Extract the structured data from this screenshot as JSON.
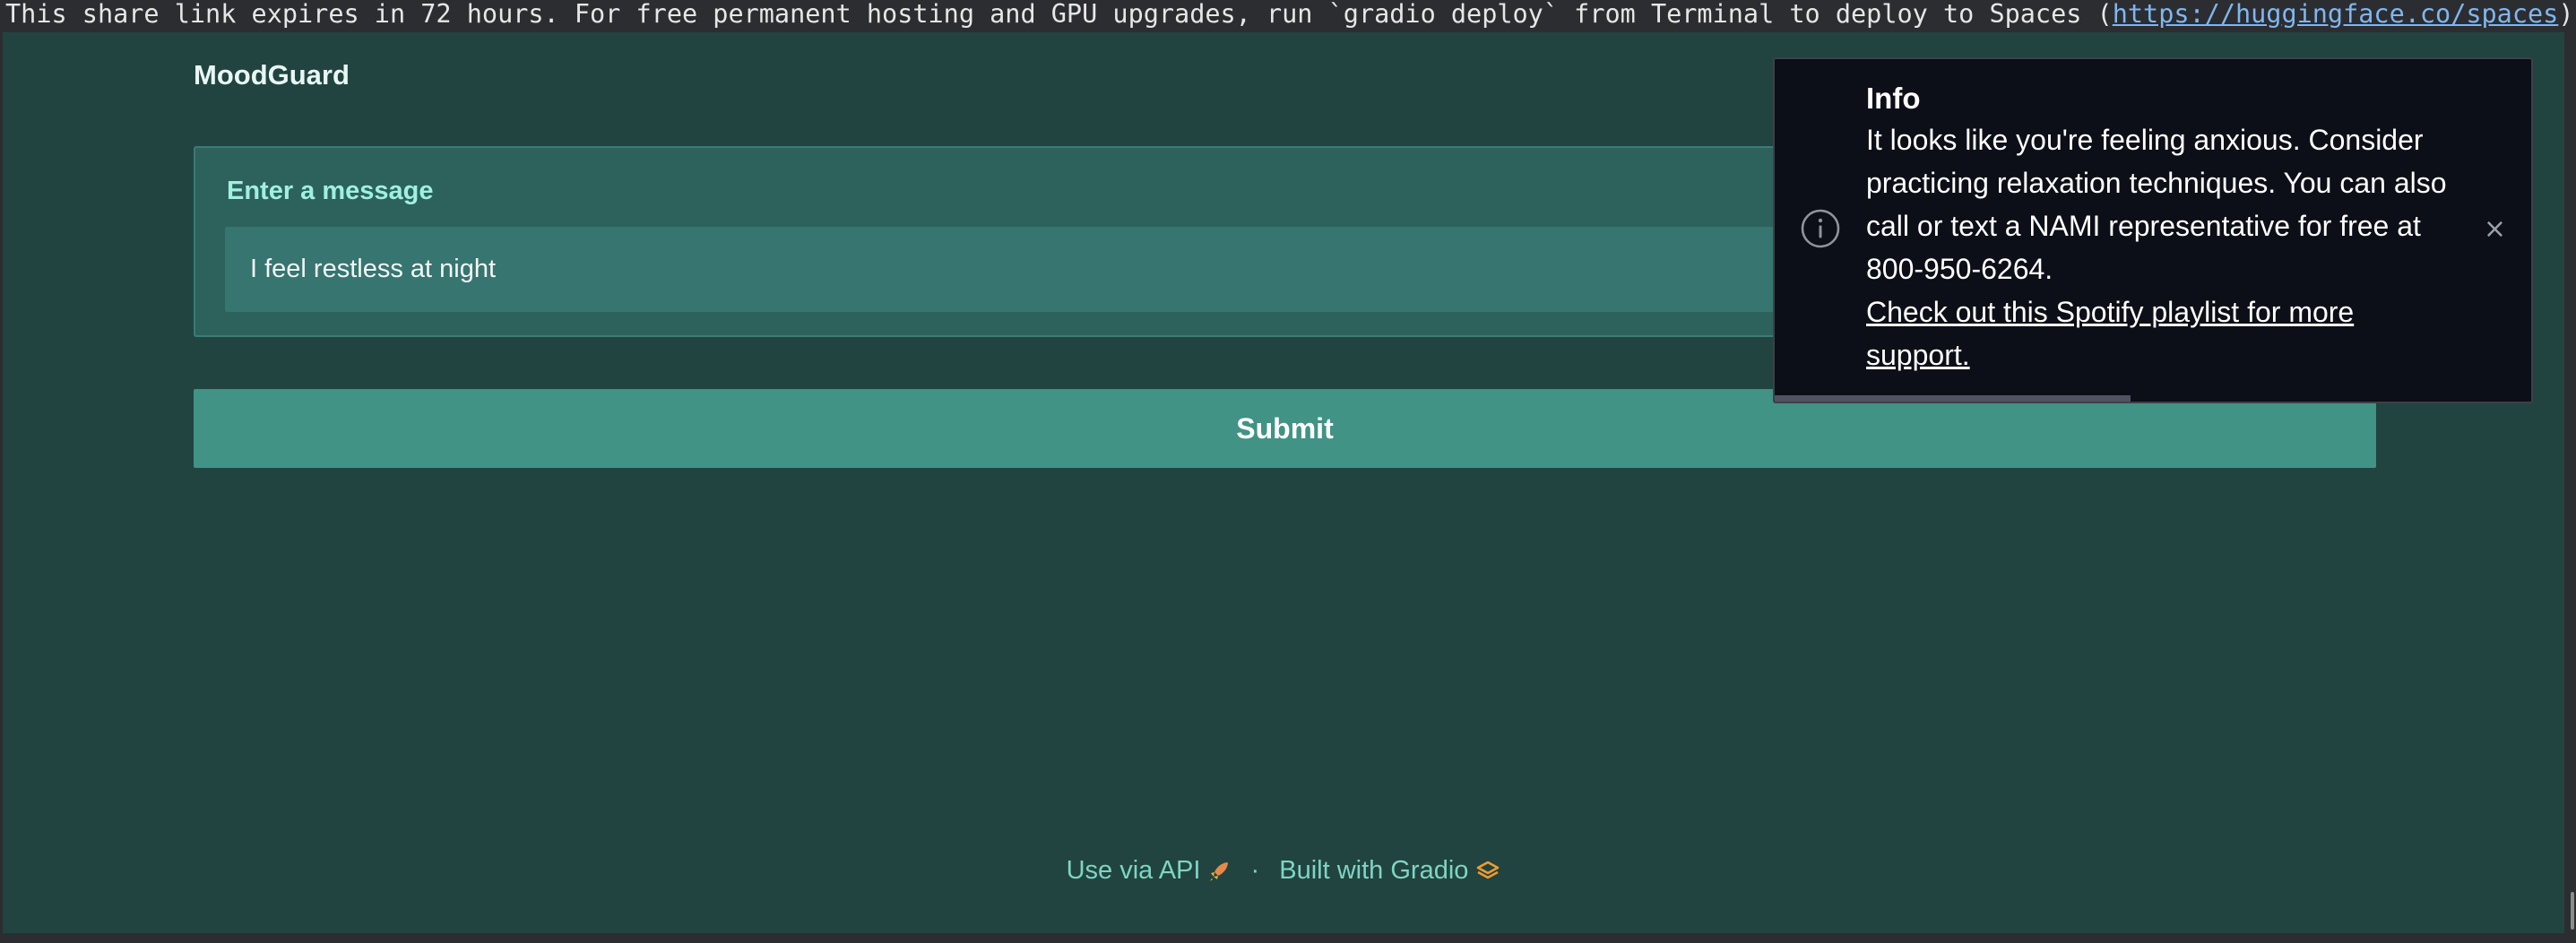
{
  "banner": {
    "text_prefix": "This share link expires in 72 hours. For free permanent hosting and GPU upgrades, run `gradio deploy` from Terminal to deploy to Spaces (",
    "link": "https://huggingface.co/spaces",
    "text_suffix": ")",
    "link_color": "#7fb6f0"
  },
  "app": {
    "title": "MoodGuard",
    "background_color": "#214440",
    "accent_color": "#409385"
  },
  "input": {
    "label": "Enter a message",
    "value": "I feel restless at night"
  },
  "submit": {
    "label": "Submit"
  },
  "footer": {
    "api_label": "Use via API",
    "api_icon": "rocket-icon",
    "separator": "·",
    "built_label": "Built with Gradio",
    "built_icon": "gradio-logo-icon"
  },
  "toast": {
    "title": "Info",
    "message": "It looks like you're feeling anxious. Consider practicing relaxation techniques. You can also call or text a NAMI representative for free at 800-950-6264.",
    "link_text": "Check out this Spotify playlist for more support.",
    "icon": "info-icon",
    "close_symbol": "×",
    "remaining_time_fraction": 0.47
  }
}
